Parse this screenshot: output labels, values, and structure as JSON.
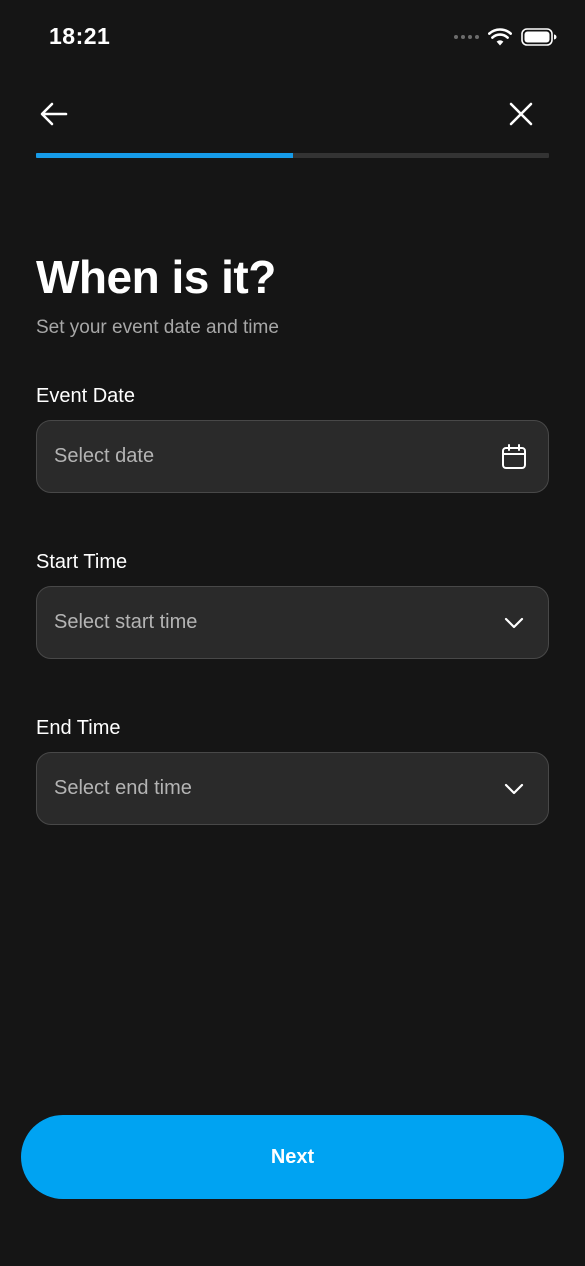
{
  "status_bar": {
    "time": "18:21"
  },
  "progress": {
    "fraction": 0.5
  },
  "header": {
    "title": "When is it?",
    "subtitle": "Set your event date and time"
  },
  "fields": {
    "event_date": {
      "label": "Event Date",
      "placeholder": "Select date",
      "icon": "calendar-icon"
    },
    "start_time": {
      "label": "Start Time",
      "placeholder": "Select start time",
      "icon": "chevron-down-icon"
    },
    "end_time": {
      "label": "End Time",
      "placeholder": "Select end time",
      "icon": "chevron-down-icon"
    }
  },
  "footer": {
    "next_label": "Next"
  },
  "colors": {
    "background": "#151515",
    "accent": "#00a3f2",
    "progress_fill": "#169be8",
    "field_bg": "#2a2a2a"
  }
}
